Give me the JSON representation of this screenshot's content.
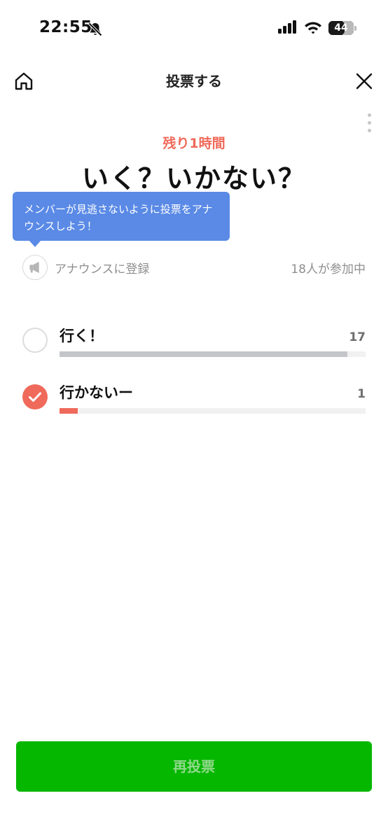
{
  "status_bar": {
    "time": "22:55",
    "battery_text": "44",
    "battery_level": 0.44,
    "icons": [
      "bell-off-icon",
      "cellular-signal-icon",
      "wifi-icon",
      "battery-icon"
    ]
  },
  "header": {
    "title": "投票する",
    "home_icon": "home-icon",
    "close_icon": "close-icon",
    "more_icon": "more-vertical-icon"
  },
  "poll": {
    "remaining": "残り1時間",
    "title": "いく？いかない？",
    "tooltip": "メンバーが見逃さないように投票をアナウンスしよう！",
    "announce_label": "アナウンスに登録",
    "participants": "18人が参加中",
    "options": [
      {
        "label": "行く！",
        "count": "17",
        "fraction": 0.94,
        "selected": false,
        "bar_color": "#c3c5c9"
      },
      {
        "label": "行かないー",
        "count": "1",
        "fraction": 0.06,
        "selected": true,
        "bar_color": "#ef6a5a"
      }
    ]
  },
  "footer": {
    "revote_label": "再投票"
  },
  "colors": {
    "accent_red": "#ef6a5a",
    "tooltip_blue": "#5a8ae6",
    "button_green": "#06b700"
  }
}
